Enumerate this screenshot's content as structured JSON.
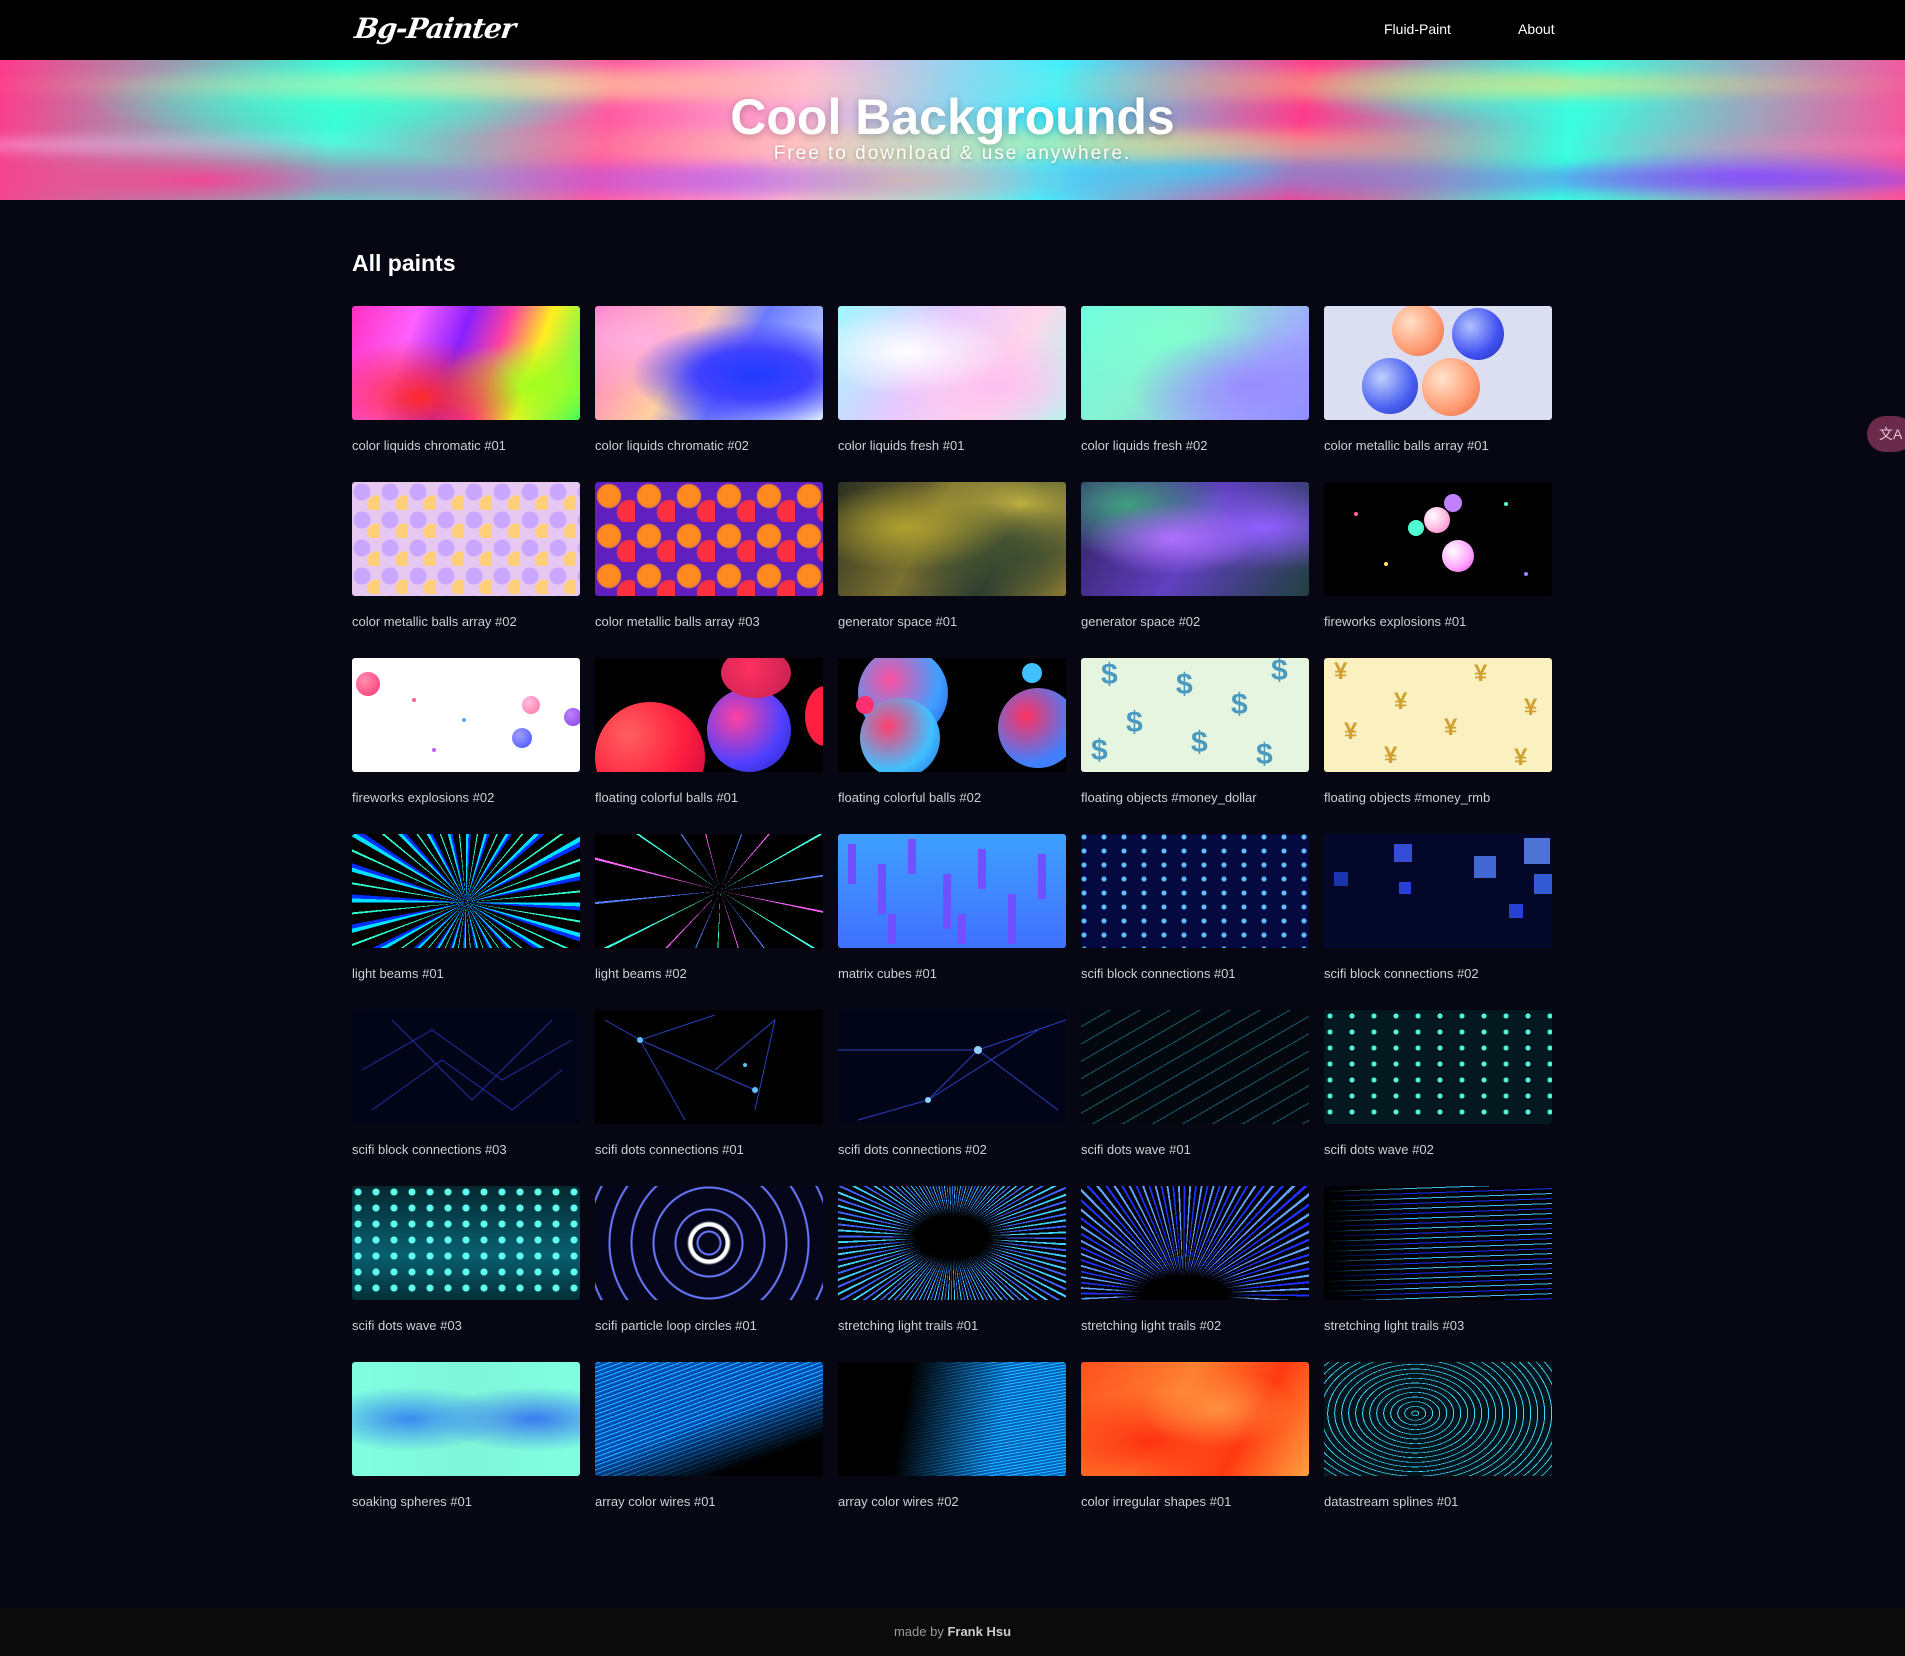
{
  "nav": {
    "logo": "Bg-Painter",
    "links": [
      "Fluid-Paint",
      "About"
    ]
  },
  "hero": {
    "title": "Cool Backgrounds",
    "subtitle": "Free to download & use anywhere."
  },
  "section": {
    "title": "All paints"
  },
  "items": [
    "color liquids chromatic #01",
    "color liquids chromatic #02",
    "color liquids fresh #01",
    "color liquids fresh #02",
    "color metallic balls array #01",
    "color metallic balls array #02",
    "color metallic balls array #03",
    "generator space #01",
    "generator space #02",
    "fireworks explosions #01",
    "fireworks explosions #02",
    "floating colorful balls #01",
    "floating colorful balls #02",
    "floating objects #money_dollar",
    "floating objects #money_rmb",
    "light beams #01",
    "light beams #02",
    "matrix cubes #01",
    "scifi block connections #01",
    "scifi block connections #02",
    "scifi block connections #03",
    "scifi dots connections #01",
    "scifi dots connections #02",
    "scifi dots wave #01",
    "scifi dots wave #02",
    "scifi dots wave #03",
    "scifi particle loop circles #01",
    "stretching light trails #01",
    "stretching light trails #02",
    "stretching light trails #03",
    "soaking spheres #01",
    "array color wires #01",
    "array color wires #02",
    "color irregular shapes #01",
    "datastream splines #01"
  ],
  "footer": {
    "prefix": "made by",
    "author": "Frank Hsu"
  },
  "side_widget": {
    "icon": "translate-icon",
    "glyph": "文A"
  }
}
